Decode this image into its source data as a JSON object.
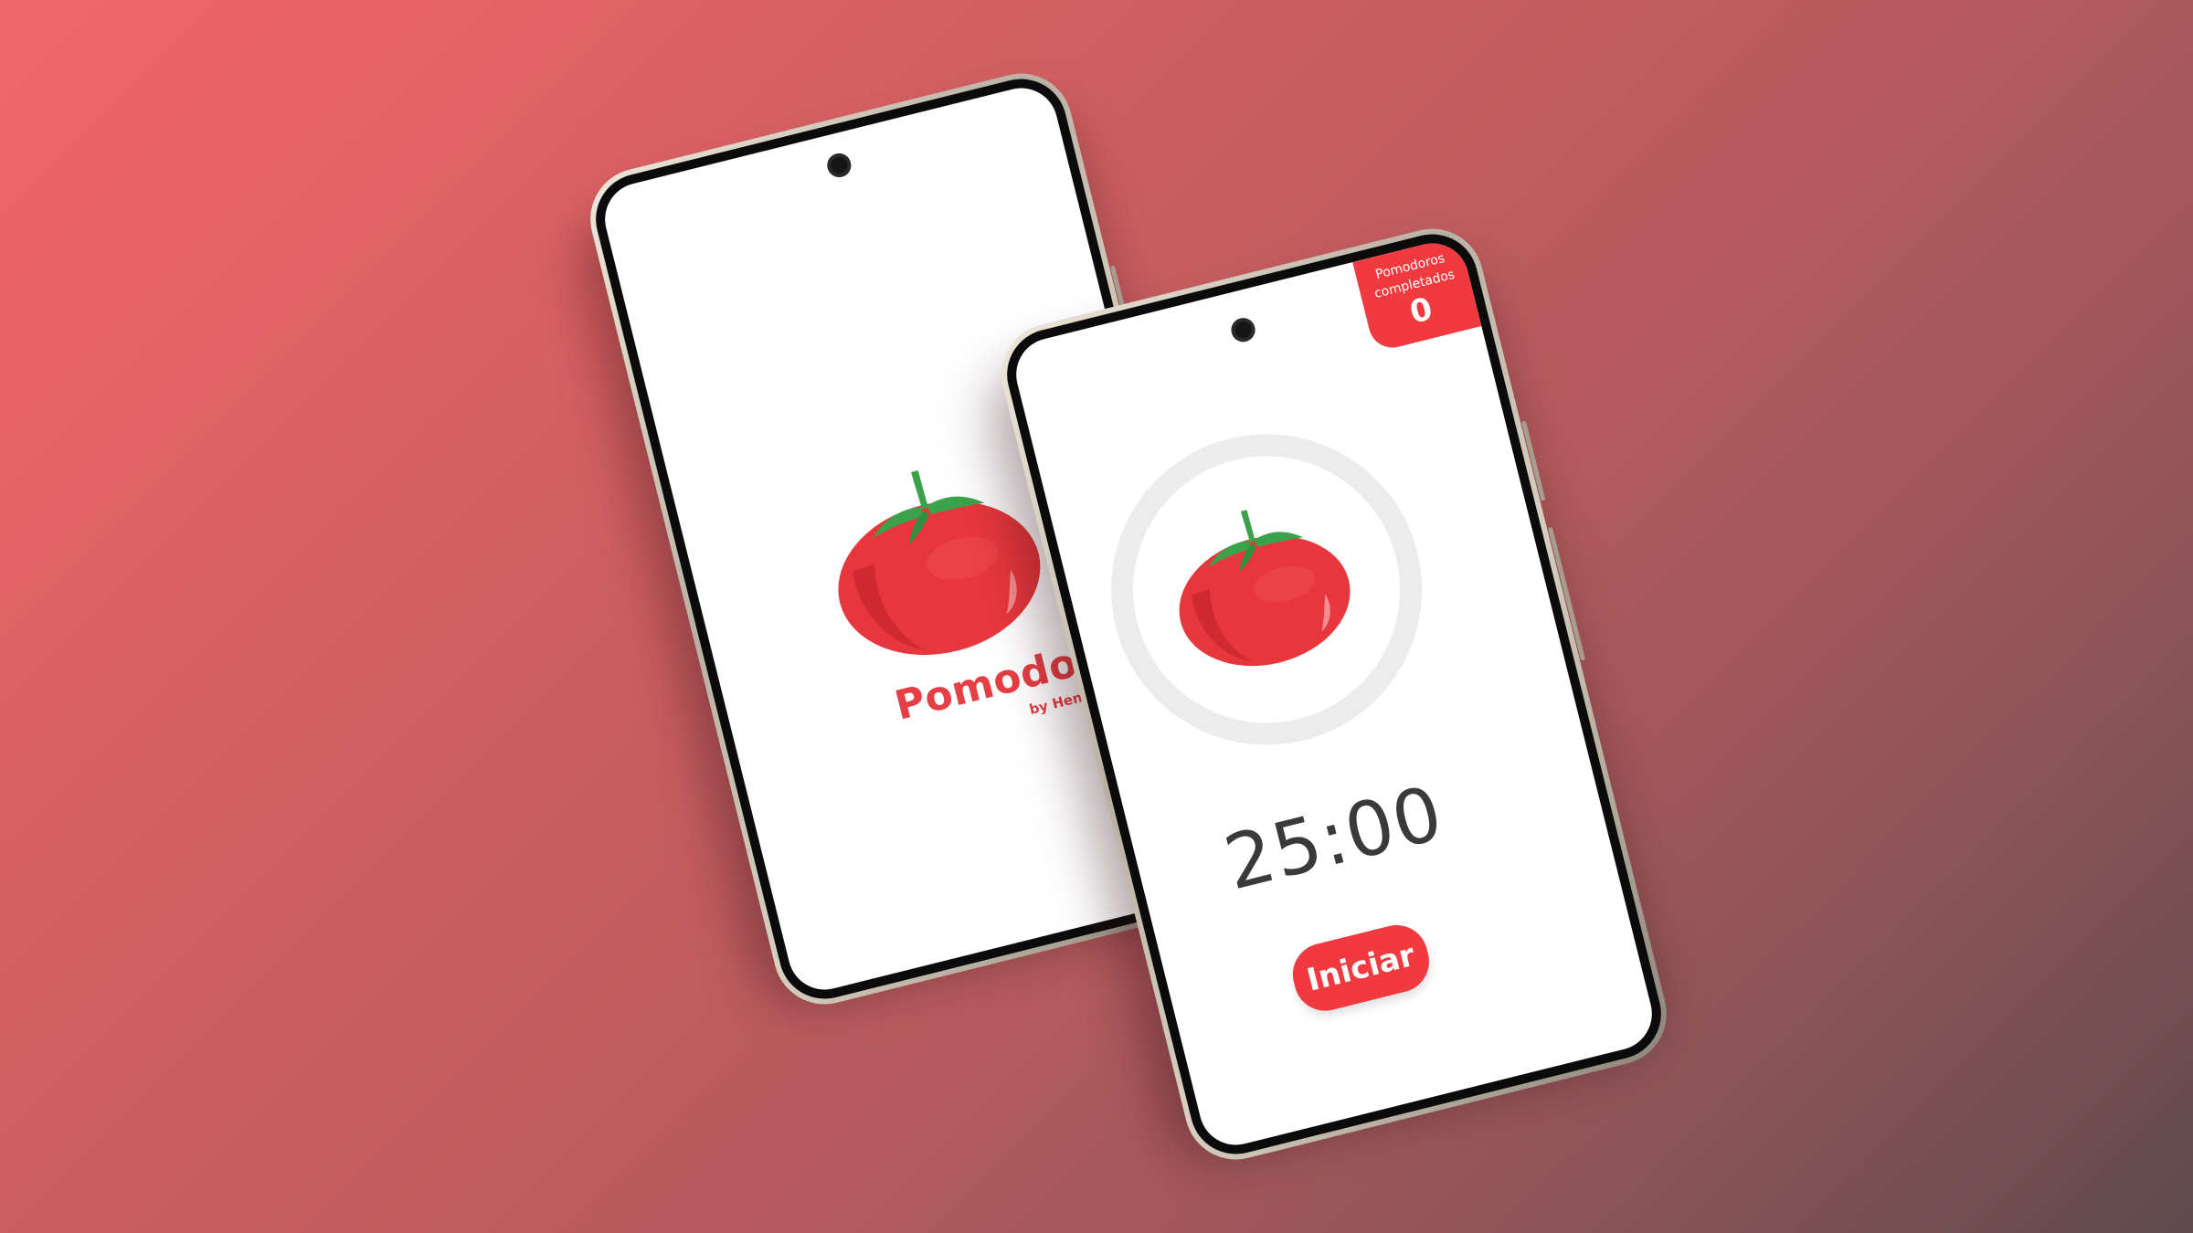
{
  "splash_screen": {
    "app_title": "Pomodoro",
    "app_author": "by Henki",
    "logo_icon": "tomato-icon"
  },
  "timer_screen": {
    "counter_label": "Pomodoros\ncompletados",
    "counter_value": "0",
    "timer_display": "25:00",
    "start_label": "Iniciar",
    "timer_icon": "tomato-icon"
  },
  "colors": {
    "accent": "#f03a3f",
    "tomato": "#e8373c",
    "leaf": "#3aa34a",
    "ring": "#ececec",
    "background_start": "#f2666a",
    "background_end": "#5f4a4d"
  }
}
